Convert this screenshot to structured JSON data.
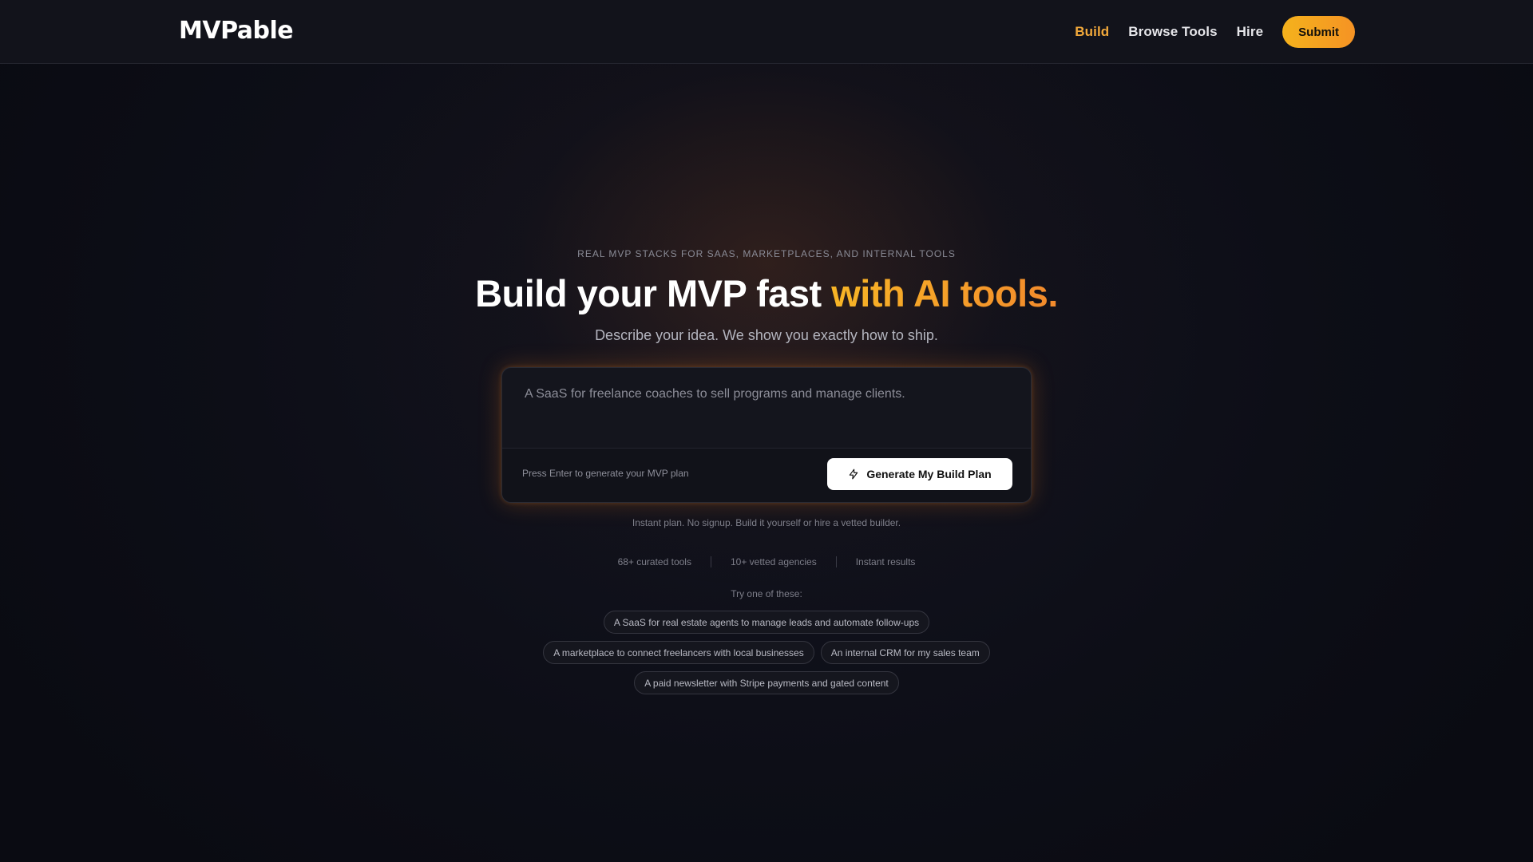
{
  "header": {
    "logo": "MVPable",
    "nav": [
      {
        "label": "Build",
        "active": true
      },
      {
        "label": "Browse Tools",
        "active": false
      },
      {
        "label": "Hire",
        "active": false
      }
    ],
    "submit_label": "Submit"
  },
  "hero": {
    "eyebrow": "REAL MVP STACKS FOR SAAS, MARKETPLACES, AND INTERNAL TOOLS",
    "headline_plain": "Build your MVP fast ",
    "headline_accent": "with AI tools.",
    "subhead": "Describe your idea. We show you exactly how to ship."
  },
  "prompt": {
    "placeholder": "A SaaS for freelance coaches to sell programs and manage clients.",
    "hint": "Press Enter to generate your MVP plan",
    "generate_label": "Generate My Build Plan"
  },
  "instant_note": "Instant plan. No signup. Build it yourself or hire a vetted builder.",
  "stats": [
    "68+ curated tools",
    "10+ vetted agencies",
    "Instant results"
  ],
  "try_label": "Try one of these:",
  "suggestions": [
    "A SaaS for real estate agents to manage leads and automate follow-ups",
    "A marketplace to connect freelancers with local businesses",
    "An internal CRM for my sales team",
    "A paid newsletter with Stripe payments and gated content"
  ],
  "colors": {
    "accent": "#f2a93b",
    "submit_bg": "#f5a623",
    "background": "#0b0c14"
  }
}
